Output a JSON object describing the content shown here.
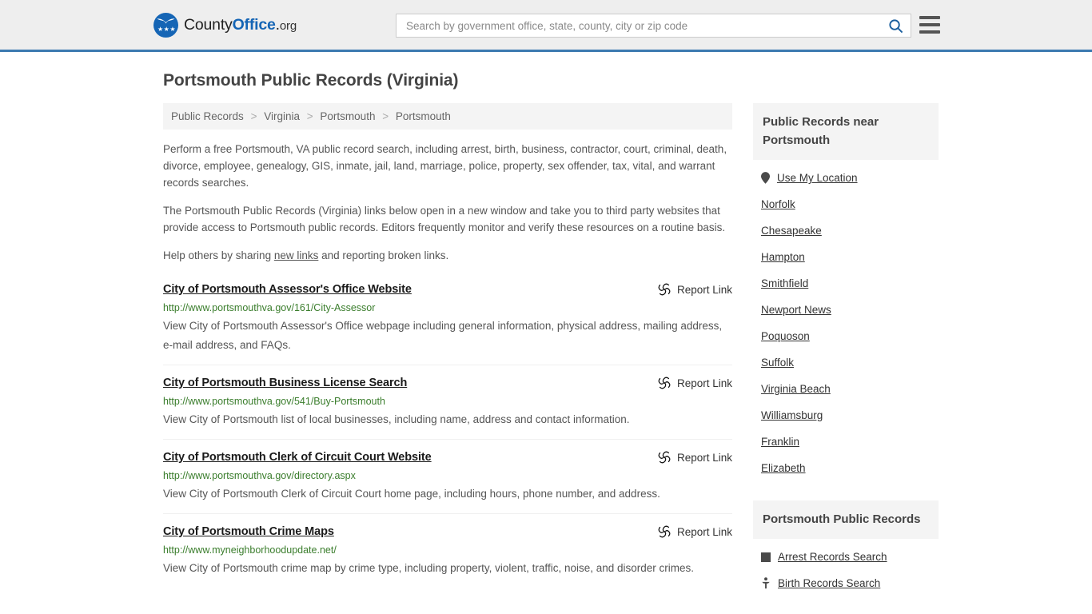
{
  "header": {
    "logo": {
      "text_county": "County",
      "text_office": "Office",
      "text_dot": ".",
      "text_org": "org",
      "stars": "★★★",
      "icon": "eagle-shield-logo"
    },
    "search": {
      "placeholder": "Search by government office, state, county, city or zip code",
      "value": "",
      "search_icon": "search-icon"
    },
    "menu_icon": "hamburger-menu-icon",
    "accent_color": "#3c7ab0"
  },
  "page": {
    "title": "Portsmouth Public Records (Virginia)"
  },
  "breadcrumb": {
    "separator": ">",
    "items": [
      {
        "label": "Public Records"
      },
      {
        "label": "Virginia"
      },
      {
        "label": "Portsmouth"
      },
      {
        "label": "Portsmouth"
      }
    ]
  },
  "intro": {
    "paragraph_1": "Perform a free Portsmouth, VA public record search, including arrest, birth, business, contractor, court, criminal, death, divorce, employee, genealogy, GIS, inmate, jail, land, marriage, police, property, sex offender, tax, vital, and warrant records searches.",
    "paragraph_2": "The Portsmouth Public Records (Virginia) links below open in a new window and take you to third party websites that provide access to Portsmouth public records. Editors frequently monitor and verify these resources on a routine basis.",
    "paragraph_3_prefix": "Help others by sharing ",
    "paragraph_3_link": "new links",
    "paragraph_3_suffix": " and reporting broken links."
  },
  "results": {
    "report_label": "Report Link",
    "report_icon": "broken-link-icon",
    "items": [
      {
        "title": "City of Portsmouth Assessor's Office Website",
        "url": "http://www.portsmouthva.gov/161/City-Assessor",
        "description": "View City of Portsmouth Assessor's Office webpage including general information, physical address, mailing address, e-mail address, and FAQs."
      },
      {
        "title": "City of Portsmouth Business License Search",
        "url": "http://www.portsmouthva.gov/541/Buy-Portsmouth",
        "description": "View City of Portsmouth list of local businesses, including name, address and contact information."
      },
      {
        "title": "City of Portsmouth Clerk of Circuit Court Website",
        "url": "http://www.portsmouthva.gov/directory.aspx",
        "description": "View City of Portsmouth Clerk of Circuit Court home page, including hours, phone number, and address."
      },
      {
        "title": "City of Portsmouth Crime Maps",
        "url": "http://www.myneighborhoodupdate.net/",
        "description": "View City of Portsmouth crime map by crime type, including property, violent, traffic, noise, and disorder crimes."
      }
    ]
  },
  "sidebar": {
    "near": {
      "heading": "Public Records near Portsmouth",
      "use_my_location": {
        "label": "Use My Location",
        "icon": "map-pin-icon"
      },
      "places": [
        {
          "label": "Norfolk"
        },
        {
          "label": "Chesapeake"
        },
        {
          "label": "Hampton"
        },
        {
          "label": "Smithfield"
        },
        {
          "label": "Newport News"
        },
        {
          "label": "Poquoson"
        },
        {
          "label": "Suffolk"
        },
        {
          "label": "Virginia Beach"
        },
        {
          "label": "Williamsburg"
        },
        {
          "label": "Franklin"
        },
        {
          "label": "Elizabeth"
        }
      ]
    },
    "records": {
      "heading": "Portsmouth Public Records",
      "items": [
        {
          "label": "Arrest Records Search",
          "icon": "arrest-records-icon"
        },
        {
          "label": "Birth Records Search",
          "icon": "birth-records-icon"
        }
      ]
    }
  }
}
